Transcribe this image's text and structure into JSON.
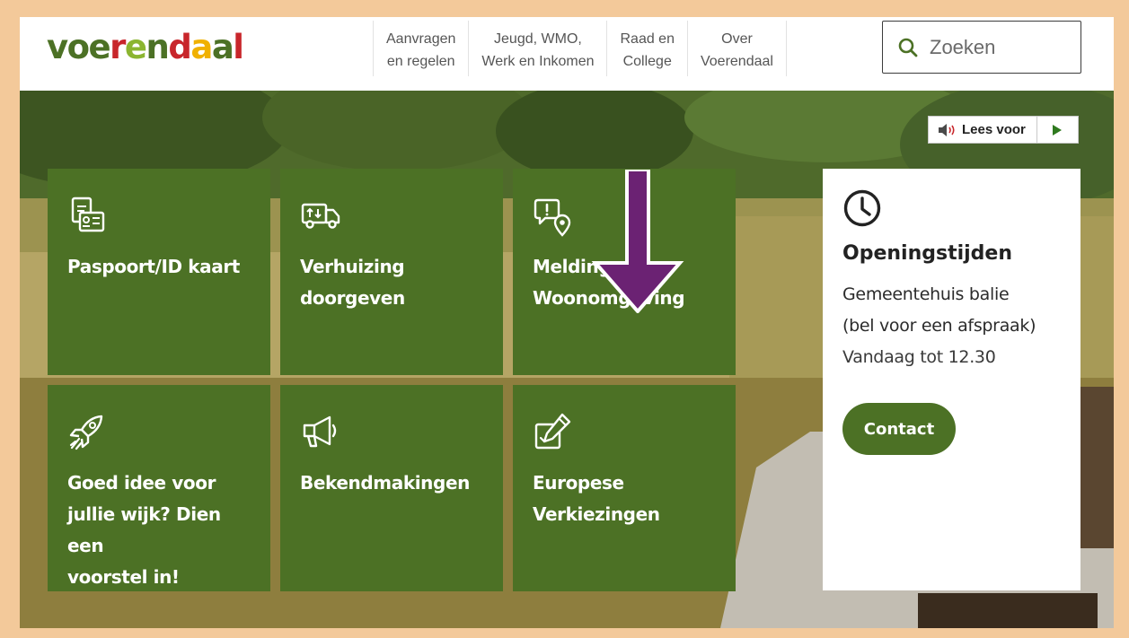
{
  "logo": {
    "letters": [
      {
        "ch": "v",
        "color": "#4c7125"
      },
      {
        "ch": "o",
        "color": "#4c7125"
      },
      {
        "ch": "e",
        "color": "#4c7125"
      },
      {
        "ch": "r",
        "color": "#c8262b"
      },
      {
        "ch": "e",
        "color": "#8bb530"
      },
      {
        "ch": "n",
        "color": "#4c7125"
      },
      {
        "ch": "d",
        "color": "#c8262b"
      },
      {
        "ch": "a",
        "color": "#f0b100"
      },
      {
        "ch": "a",
        "color": "#4c7125"
      },
      {
        "ch": "l",
        "color": "#c8262b"
      }
    ],
    "text": "voerendaal"
  },
  "nav": {
    "items": [
      {
        "line1": "Aanvragen",
        "line2": "en regelen"
      },
      {
        "line1": "Jeugd, WMO,",
        "line2": "Werk en Inkomen"
      },
      {
        "line1": "Raad en",
        "line2": "College"
      },
      {
        "line1": "Over",
        "line2": "Voerendaal"
      }
    ]
  },
  "search": {
    "placeholder": "Zoeken",
    "icon": "search-icon"
  },
  "read_aloud": {
    "label": "Lees voor",
    "speaker_icon": "speaker-icon",
    "play_icon": "play-icon"
  },
  "tiles": [
    {
      "label_lines": [
        "Paspoort/ID kaart"
      ],
      "icon": "id-card-icon"
    },
    {
      "label_lines": [
        "Verhuizing",
        "doorgeven"
      ],
      "icon": "moving-truck-icon"
    },
    {
      "label_lines": [
        "Melding",
        "Woonomgeving"
      ],
      "icon": "report-location-icon"
    },
    {
      "label_lines": [
        "Goed idee voor",
        "jullie wijk? Dien een",
        "voorstel in!"
      ],
      "icon": "rocket-icon"
    },
    {
      "label_lines": [
        "Bekendmakingen"
      ],
      "icon": "megaphone-icon"
    },
    {
      "label_lines": [
        "Europese",
        "Verkiezingen"
      ],
      "icon": "ballot-pen-icon"
    }
  ],
  "opening_hours": {
    "icon": "clock-icon",
    "title": "Openingstijden",
    "location_line1": "Gemeentehuis balie",
    "location_line2": "(bel voor een afspraak)",
    "today": "Vandaag tot 12.30",
    "contact_label": "Contact"
  },
  "colors": {
    "brand_green": "#4c7125",
    "frame_border": "#f3c99a",
    "arrow": "#6b2273"
  }
}
